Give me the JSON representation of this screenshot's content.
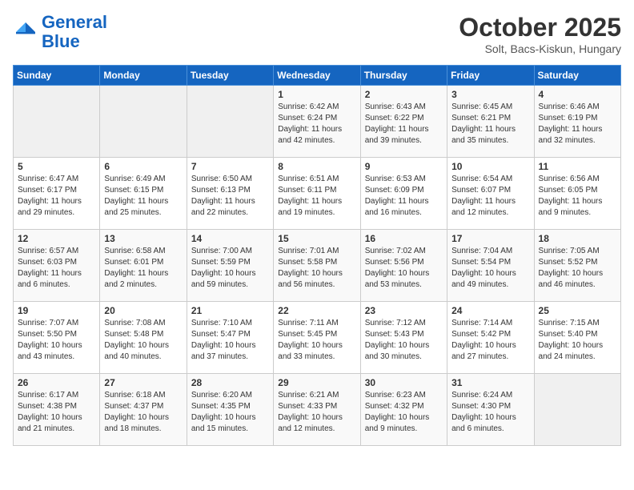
{
  "header": {
    "logo_line1": "General",
    "logo_line2": "Blue",
    "month": "October 2025",
    "location": "Solt, Bacs-Kiskun, Hungary"
  },
  "weekdays": [
    "Sunday",
    "Monday",
    "Tuesday",
    "Wednesday",
    "Thursday",
    "Friday",
    "Saturday"
  ],
  "weeks": [
    [
      {
        "day": "",
        "info": ""
      },
      {
        "day": "",
        "info": ""
      },
      {
        "day": "",
        "info": ""
      },
      {
        "day": "1",
        "info": "Sunrise: 6:42 AM\nSunset: 6:24 PM\nDaylight: 11 hours\nand 42 minutes."
      },
      {
        "day": "2",
        "info": "Sunrise: 6:43 AM\nSunset: 6:22 PM\nDaylight: 11 hours\nand 39 minutes."
      },
      {
        "day": "3",
        "info": "Sunrise: 6:45 AM\nSunset: 6:21 PM\nDaylight: 11 hours\nand 35 minutes."
      },
      {
        "day": "4",
        "info": "Sunrise: 6:46 AM\nSunset: 6:19 PM\nDaylight: 11 hours\nand 32 minutes."
      }
    ],
    [
      {
        "day": "5",
        "info": "Sunrise: 6:47 AM\nSunset: 6:17 PM\nDaylight: 11 hours\nand 29 minutes."
      },
      {
        "day": "6",
        "info": "Sunrise: 6:49 AM\nSunset: 6:15 PM\nDaylight: 11 hours\nand 25 minutes."
      },
      {
        "day": "7",
        "info": "Sunrise: 6:50 AM\nSunset: 6:13 PM\nDaylight: 11 hours\nand 22 minutes."
      },
      {
        "day": "8",
        "info": "Sunrise: 6:51 AM\nSunset: 6:11 PM\nDaylight: 11 hours\nand 19 minutes."
      },
      {
        "day": "9",
        "info": "Sunrise: 6:53 AM\nSunset: 6:09 PM\nDaylight: 11 hours\nand 16 minutes."
      },
      {
        "day": "10",
        "info": "Sunrise: 6:54 AM\nSunset: 6:07 PM\nDaylight: 11 hours\nand 12 minutes."
      },
      {
        "day": "11",
        "info": "Sunrise: 6:56 AM\nSunset: 6:05 PM\nDaylight: 11 hours\nand 9 minutes."
      }
    ],
    [
      {
        "day": "12",
        "info": "Sunrise: 6:57 AM\nSunset: 6:03 PM\nDaylight: 11 hours\nand 6 minutes."
      },
      {
        "day": "13",
        "info": "Sunrise: 6:58 AM\nSunset: 6:01 PM\nDaylight: 11 hours\nand 2 minutes."
      },
      {
        "day": "14",
        "info": "Sunrise: 7:00 AM\nSunset: 5:59 PM\nDaylight: 10 hours\nand 59 minutes."
      },
      {
        "day": "15",
        "info": "Sunrise: 7:01 AM\nSunset: 5:58 PM\nDaylight: 10 hours\nand 56 minutes."
      },
      {
        "day": "16",
        "info": "Sunrise: 7:02 AM\nSunset: 5:56 PM\nDaylight: 10 hours\nand 53 minutes."
      },
      {
        "day": "17",
        "info": "Sunrise: 7:04 AM\nSunset: 5:54 PM\nDaylight: 10 hours\nand 49 minutes."
      },
      {
        "day": "18",
        "info": "Sunrise: 7:05 AM\nSunset: 5:52 PM\nDaylight: 10 hours\nand 46 minutes."
      }
    ],
    [
      {
        "day": "19",
        "info": "Sunrise: 7:07 AM\nSunset: 5:50 PM\nDaylight: 10 hours\nand 43 minutes."
      },
      {
        "day": "20",
        "info": "Sunrise: 7:08 AM\nSunset: 5:48 PM\nDaylight: 10 hours\nand 40 minutes."
      },
      {
        "day": "21",
        "info": "Sunrise: 7:10 AM\nSunset: 5:47 PM\nDaylight: 10 hours\nand 37 minutes."
      },
      {
        "day": "22",
        "info": "Sunrise: 7:11 AM\nSunset: 5:45 PM\nDaylight: 10 hours\nand 33 minutes."
      },
      {
        "day": "23",
        "info": "Sunrise: 7:12 AM\nSunset: 5:43 PM\nDaylight: 10 hours\nand 30 minutes."
      },
      {
        "day": "24",
        "info": "Sunrise: 7:14 AM\nSunset: 5:42 PM\nDaylight: 10 hours\nand 27 minutes."
      },
      {
        "day": "25",
        "info": "Sunrise: 7:15 AM\nSunset: 5:40 PM\nDaylight: 10 hours\nand 24 minutes."
      }
    ],
    [
      {
        "day": "26",
        "info": "Sunrise: 6:17 AM\nSunset: 4:38 PM\nDaylight: 10 hours\nand 21 minutes."
      },
      {
        "day": "27",
        "info": "Sunrise: 6:18 AM\nSunset: 4:37 PM\nDaylight: 10 hours\nand 18 minutes."
      },
      {
        "day": "28",
        "info": "Sunrise: 6:20 AM\nSunset: 4:35 PM\nDaylight: 10 hours\nand 15 minutes."
      },
      {
        "day": "29",
        "info": "Sunrise: 6:21 AM\nSunset: 4:33 PM\nDaylight: 10 hours\nand 12 minutes."
      },
      {
        "day": "30",
        "info": "Sunrise: 6:23 AM\nSunset: 4:32 PM\nDaylight: 10 hours\nand 9 minutes."
      },
      {
        "day": "31",
        "info": "Sunrise: 6:24 AM\nSunset: 4:30 PM\nDaylight: 10 hours\nand 6 minutes."
      },
      {
        "day": "",
        "info": ""
      }
    ]
  ]
}
